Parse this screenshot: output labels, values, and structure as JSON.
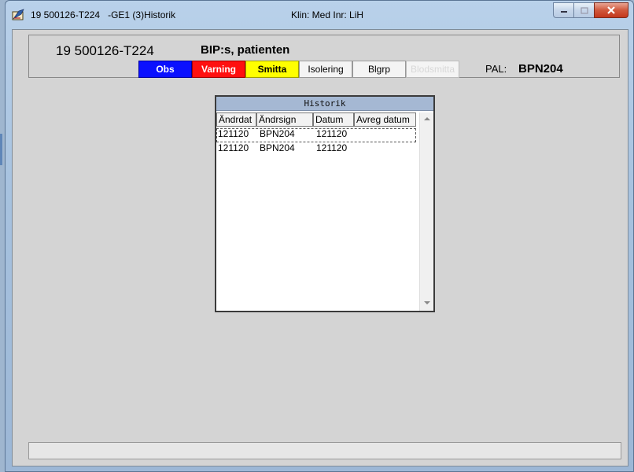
{
  "window": {
    "title": "19 500126-T224   -GE1 (3)Historik",
    "clinic": "Klin: Med  Inr: LiH"
  },
  "header": {
    "patient_id": "19 500126-T224",
    "patient_name": "BIP:s, patienten",
    "flags": {
      "obs": "Obs",
      "varning": "Varning",
      "smitta": "Smitta",
      "isolering": "Isolering",
      "blgrp": "Blgrp",
      "disabled": "Blodsmitta"
    },
    "pal_label": "PAL:",
    "pal_value": "BPN204"
  },
  "historik": {
    "title": "Historik",
    "columns": [
      "Ändrdat",
      "Ändrsign",
      "Datum",
      "Avreg datum"
    ],
    "rows": [
      {
        "andrdat": "121120",
        "andrsign": "BPN204",
        "datum": "121120",
        "avreg": ""
      },
      {
        "andrdat": "121120",
        "andrsign": "BPN204",
        "datum": "121120",
        "avreg": ""
      }
    ]
  },
  "statusbar": {
    "text": ""
  },
  "colors": {
    "obs": "#0a10ff",
    "varning": "#ff1010",
    "smitta": "#ffff00",
    "client_bg": "#d4d4d4"
  },
  "icons": [
    "app-icon",
    "minimize-icon",
    "maximize-icon",
    "close-icon",
    "scroll-up-icon",
    "scroll-down-icon"
  ]
}
